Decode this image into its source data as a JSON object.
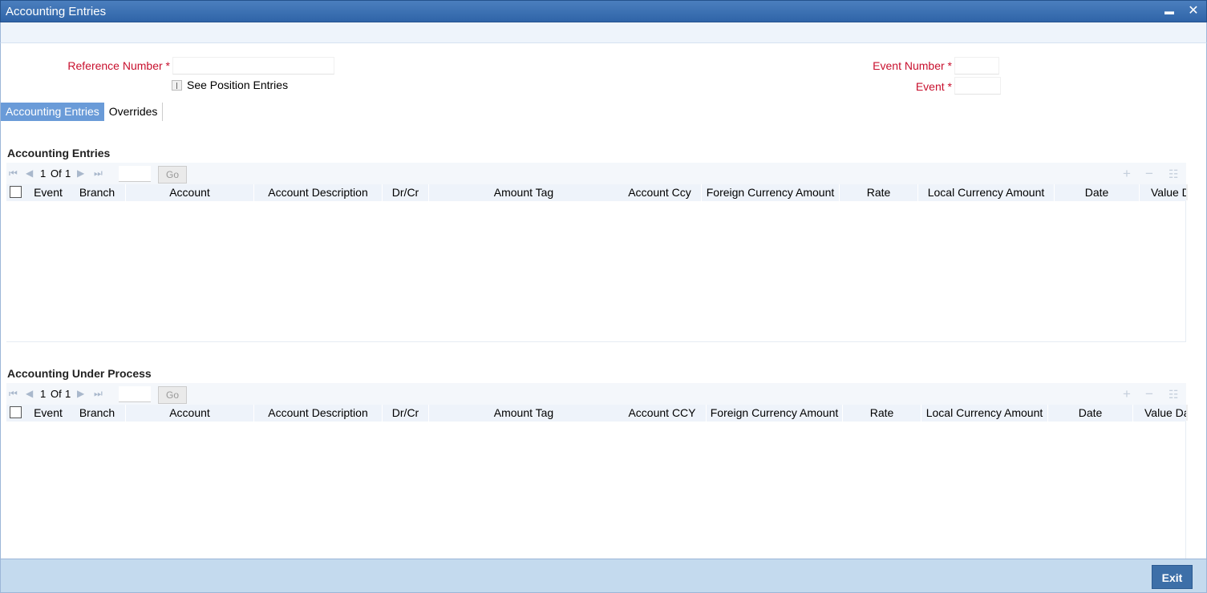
{
  "window": {
    "title": "Accounting Entries",
    "minimize_glyph": "▬",
    "close_glyph": "✕"
  },
  "form": {
    "reference_number_label": "Reference Number",
    "reference_number_value": "",
    "see_position_entries_label": "See Position Entries",
    "event_number_label": "Event Number",
    "event_number_value": "",
    "event_label": "Event",
    "event_value": "",
    "required_marker": "*"
  },
  "tabs": [
    {
      "label": "Accounting Entries",
      "active": true
    },
    {
      "label": "Overrides",
      "active": false
    }
  ],
  "grid1": {
    "title": "Accounting Entries",
    "pager": {
      "current": "1",
      "of_label": "Of",
      "total": "1",
      "go_label": "Go"
    },
    "columns": [
      "Event",
      "Branch",
      "Account",
      "Account Description",
      "Dr/Cr",
      "Amount Tag",
      "Account Ccy",
      "Foreign Currency Amount",
      "Rate",
      "Local Currency Amount",
      "Date",
      "Value Date"
    ]
  },
  "grid2": {
    "title": "Accounting Under Process",
    "pager": {
      "current": "1",
      "of_label": "Of",
      "total": "1",
      "go_label": "Go"
    },
    "columns": [
      "Event",
      "Branch",
      "Account",
      "Account Description",
      "Dr/Cr",
      "Amount Tag",
      "Account CCY",
      "Foreign Currency Amount",
      "Rate",
      "Local Currency Amount",
      "Date",
      "Value Date"
    ]
  },
  "footer": {
    "exit_label": "Exit"
  },
  "colors": {
    "title_bar": "#3a6fb0",
    "tab_active": "#6a9bd8",
    "label_red": "#c8102e",
    "footer": "#c4daee"
  }
}
